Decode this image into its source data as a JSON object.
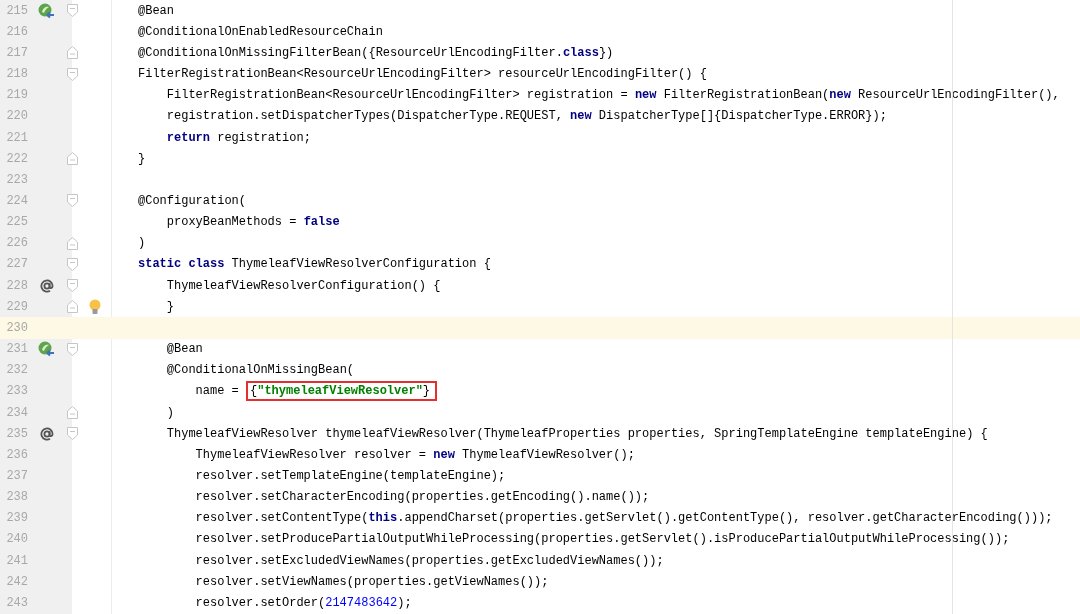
{
  "editor": {
    "lines": [
      {
        "number": "215",
        "current": false,
        "icon": {
          "kind": "bean"
        },
        "fold": {
          "kind": "open"
        },
        "tokens": [
          {
            "kind": "plain",
            "text": "@Bean"
          }
        ]
      },
      {
        "number": "216",
        "current": false,
        "tokens": [
          {
            "kind": "plain",
            "text": "@ConditionalOnEnabledResourceChain"
          }
        ]
      },
      {
        "number": "217",
        "current": false,
        "fold": {
          "kind": "close"
        },
        "tokens": [
          {
            "kind": "plain",
            "text": "@ConditionalOnMissingFilterBean({ResourceUrlEncodingFilter."
          },
          {
            "kind": "keyword",
            "text": "class"
          },
          {
            "kind": "plain",
            "text": "})"
          }
        ]
      },
      {
        "number": "218",
        "current": false,
        "fold": {
          "kind": "open"
        },
        "tokens": [
          {
            "kind": "plain",
            "text": "FilterRegistrationBean<ResourceUrlEncodingFilter> resourceUrlEncodingFilter() {"
          }
        ]
      },
      {
        "number": "219",
        "current": false,
        "tokens": [
          {
            "kind": "plain",
            "text": "    FilterRegistrationBean<ResourceUrlEncodingFilter> registration = "
          },
          {
            "kind": "keyword",
            "text": "new"
          },
          {
            "kind": "plain",
            "text": " FilterRegistrationBean("
          },
          {
            "kind": "keyword",
            "text": "new"
          },
          {
            "kind": "plain",
            "text": " ResourceUrlEncodingFilter(),"
          }
        ]
      },
      {
        "number": "220",
        "current": false,
        "tokens": [
          {
            "kind": "plain",
            "text": "    registration.setDispatcherTypes(DispatcherType.REQUEST, "
          },
          {
            "kind": "keyword",
            "text": "new"
          },
          {
            "kind": "plain",
            "text": " DispatcherType[]{DispatcherType.ERROR});"
          }
        ]
      },
      {
        "number": "221",
        "current": false,
        "tokens": [
          {
            "kind": "keyword",
            "text": "    return"
          },
          {
            "kind": "plain",
            "text": " registration;"
          }
        ]
      },
      {
        "number": "222",
        "current": false,
        "fold": {
          "kind": "close"
        },
        "tokens": [
          {
            "kind": "plain",
            "text": "}"
          }
        ]
      },
      {
        "number": "223",
        "current": false
      },
      {
        "number": "224",
        "current": false,
        "fold": {
          "kind": "open"
        },
        "tokens": [
          {
            "kind": "plain",
            "text": "@Configuration("
          }
        ]
      },
      {
        "number": "225",
        "current": false,
        "tokens": [
          {
            "kind": "plain",
            "text": "    proxyBeanMethods = "
          },
          {
            "kind": "keyword",
            "text": "false"
          }
        ]
      },
      {
        "number": "226",
        "current": false,
        "fold": {
          "kind": "close"
        },
        "tokens": [
          {
            "kind": "plain",
            "text": ")"
          }
        ]
      },
      {
        "number": "227",
        "current": false,
        "fold": {
          "kind": "open"
        },
        "tokens": [
          {
            "kind": "keyword",
            "text": "static class"
          },
          {
            "kind": "plain",
            "text": " ThymeleafViewResolverConfiguration {"
          }
        ]
      },
      {
        "number": "228",
        "current": false,
        "icon": {
          "kind": "override"
        },
        "fold": {
          "kind": "open"
        },
        "tokens": [
          {
            "kind": "plain",
            "text": "    ThymeleafViewResolverConfiguration() {"
          }
        ]
      },
      {
        "number": "229",
        "current": false,
        "icon": {
          "kind": "bulb"
        },
        "fold": {
          "kind": "close"
        },
        "tokens": [
          {
            "kind": "plain",
            "text": "    }"
          }
        ]
      },
      {
        "number": "230",
        "current": true
      },
      {
        "number": "231",
        "current": false,
        "icon": {
          "kind": "bean"
        },
        "fold": {
          "kind": "open"
        },
        "tokens": [
          {
            "kind": "plain",
            "text": "    @Bean"
          }
        ]
      },
      {
        "number": "232",
        "current": false,
        "tokens": [
          {
            "kind": "plain",
            "text": "    @ConditionalOnMissingBean("
          }
        ]
      },
      {
        "number": "233",
        "current": false,
        "tokens": [
          {
            "kind": "plain",
            "text": "        name = "
          },
          {
            "kind": "box",
            "tokens": [
              {
                "kind": "plain",
                "text": "{"
              },
              {
                "kind": "string",
                "text": "\"thymeleafViewResolver\""
              },
              {
                "kind": "plain",
                "text": "}"
              }
            ]
          }
        ]
      },
      {
        "number": "234",
        "current": false,
        "fold": {
          "kind": "close"
        },
        "tokens": [
          {
            "kind": "plain",
            "text": "    )"
          }
        ]
      },
      {
        "number": "235",
        "current": false,
        "icon": {
          "kind": "override"
        },
        "fold": {
          "kind": "open"
        },
        "tokens": [
          {
            "kind": "plain",
            "text": "    ThymeleafViewResolver thymeleafViewResolver(ThymeleafProperties properties, SpringTemplateEngine templateEngine) {"
          }
        ]
      },
      {
        "number": "236",
        "current": false,
        "tokens": [
          {
            "kind": "plain",
            "text": "        ThymeleafViewResolver resolver = "
          },
          {
            "kind": "keyword",
            "text": "new"
          },
          {
            "kind": "plain",
            "text": " ThymeleafViewResolver();"
          }
        ]
      },
      {
        "number": "237",
        "current": false,
        "tokens": [
          {
            "kind": "plain",
            "text": "        resolver.setTemplateEngine(templateEngine);"
          }
        ]
      },
      {
        "number": "238",
        "current": false,
        "tokens": [
          {
            "kind": "plain",
            "text": "        resolver.setCharacterEncoding(properties.getEncoding().name());"
          }
        ]
      },
      {
        "number": "239",
        "current": false,
        "tokens": [
          {
            "kind": "plain",
            "text": "        resolver.setContentType("
          },
          {
            "kind": "keyword",
            "text": "this"
          },
          {
            "kind": "plain",
            "text": ".appendCharset(properties.getServlet().getContentType(), resolver.getCharacterEncoding()));"
          }
        ]
      },
      {
        "number": "240",
        "current": false,
        "tokens": [
          {
            "kind": "plain",
            "text": "        resolver.setProducePartialOutputWhileProcessing(properties.getServlet().isProducePartialOutputWhileProcessing());"
          }
        ]
      },
      {
        "number": "241",
        "current": false,
        "tokens": [
          {
            "kind": "plain",
            "text": "        resolver.setExcludedViewNames(properties.getExcludedViewNames());"
          }
        ]
      },
      {
        "number": "242",
        "current": false,
        "tokens": [
          {
            "kind": "plain",
            "text": "        resolver.setViewNames(properties.getViewNames());"
          }
        ]
      },
      {
        "number": "243",
        "current": false,
        "tokens": [
          {
            "kind": "plain",
            "text": "        resolver.setOrder("
          },
          {
            "kind": "number",
            "text": "2147483642"
          },
          {
            "kind": "plain",
            "text": ");"
          }
        ]
      }
    ]
  }
}
